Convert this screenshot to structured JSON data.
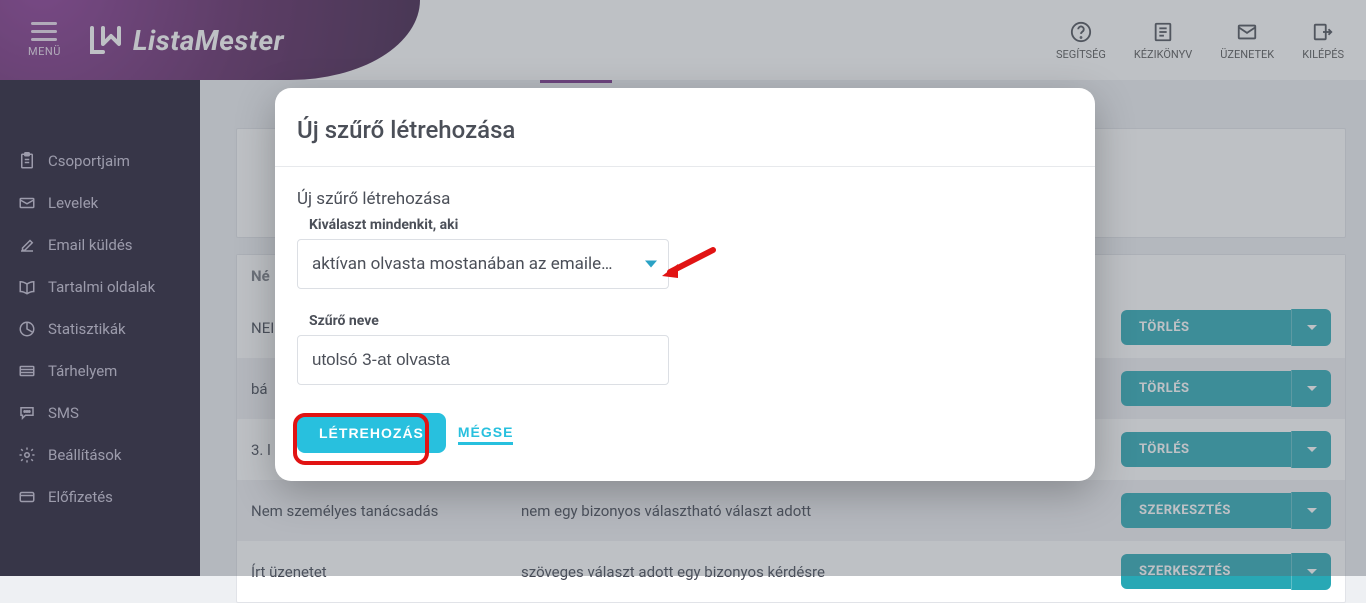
{
  "header": {
    "menu_label": "MENÜ",
    "brand": "ListaMester",
    "actions": {
      "help": "SEGÍTSÉG",
      "manual": "KÉZIKÖNYV",
      "msgs": "ÜZENETEK",
      "logout": "KILÉPÉS"
    }
  },
  "sidebar": {
    "items": [
      {
        "key": "groups",
        "label": "Csoportjaim"
      },
      {
        "key": "letters",
        "label": "Levelek"
      },
      {
        "key": "send",
        "label": "Email küldés"
      },
      {
        "key": "pages",
        "label": "Tartalmi oldalak"
      },
      {
        "key": "stats",
        "label": "Statisztikák"
      },
      {
        "key": "storage",
        "label": "Tárhelyem"
      },
      {
        "key": "sms",
        "label": "SMS"
      },
      {
        "key": "settings",
        "label": "Beállítások"
      },
      {
        "key": "subscribe",
        "label": "Előfizetés"
      }
    ]
  },
  "table": {
    "col_name": "Né",
    "rows": [
      {
        "name": "NEI",
        "desc": "",
        "primary": "TÖRLÉS"
      },
      {
        "name": "bá",
        "desc": "",
        "primary": "TÖRLÉS"
      },
      {
        "name": "3. l",
        "desc": "",
        "primary": "TÖRLÉS"
      },
      {
        "name": "Nem személyes tanácsadás",
        "desc": "nem egy bizonyos választható választ adott",
        "primary": "SZERKESZTÉS"
      },
      {
        "name": "Írt üzenetet",
        "desc": "szöveges választ adott egy bizonyos kérdésre",
        "primary": "SZERKESZTÉS"
      }
    ]
  },
  "modal": {
    "title": "Új szűrő létrehozása",
    "subtitle": "Új szűrő létrehozása",
    "select_label": "Kiválaszt mindenkit, aki",
    "select_value": "aktívan olvasta mostanában az emaile…",
    "name_label": "Szűrő neve",
    "name_value": "utolsó 3-at olvasta",
    "create": "LÉTREHOZÁS",
    "cancel": "MÉGSE"
  }
}
